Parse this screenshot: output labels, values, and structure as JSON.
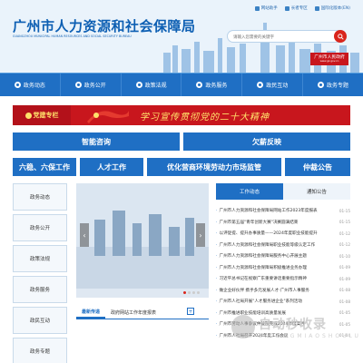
{
  "header": {
    "title": "广州市人力资源和社会保障局",
    "subtitle": "GUANGZHOU MUNICIPAL HUMAN RESOURCES AND SOCIAL SECURITY BUREAU",
    "top_links": [
      "网站助手",
      "长者专区",
      "国际化版本(EN)"
    ],
    "search_placeholder": "请输入您需要的关键字",
    "gov_badge": "广州市人民政府",
    "gov_badge_url": "www.gz.gov.cn"
  },
  "nav": {
    "items": [
      "政务动态",
      "政务公开",
      "政策法规",
      "政务服务",
      "政民互动",
      "政务专题"
    ]
  },
  "banner": {
    "label": "党建专栏",
    "slogan": "学习宣传贯彻党的二十大精神"
  },
  "buttons": {
    "row1": [
      "智能咨询",
      "欠薪反映"
    ],
    "row2": [
      "六稳、六保工作",
      "人才工作",
      "优化营商环境劳动力市场监管",
      "仲裁公告"
    ]
  },
  "left_menu": [
    "政务动态",
    "政务公开",
    "政策法规",
    "政务服务",
    "政民互动",
    "政务专题"
  ],
  "mid_tabs": [
    "最新传递",
    "政府网站工作年度报表"
  ],
  "mid_more": "+",
  "news": {
    "tabs": [
      "工作动态",
      "通知公告"
    ],
    "items": [
      {
        "title": "广州市人力资源和社会保障局网站工作2023年度报表",
        "date": "01-15"
      },
      {
        "title": "广州市第五届\"青年创新大赛\"决赛圆满结束",
        "date": "01-15"
      },
      {
        "title": "以评促提、提升办事质量——2024年度职业技能提升",
        "date": "01-12"
      },
      {
        "title": "广州市人力资源和社会保障局职业技能等级认定工作",
        "date": "01-12"
      },
      {
        "title": "广州市人力资源和社会保障局服务中心开展主题",
        "date": "01-10"
      },
      {
        "title": "广州市人力资源和社会保障局积极推进业务办理",
        "date": "01-09"
      },
      {
        "title": "习近平总书记在视察广东重要讲话重要指示精神",
        "date": "01-09"
      },
      {
        "title": "做企业好伙伴 携手多元发展人才·广州市人事服务",
        "date": "01-08"
      },
      {
        "title": "广州市人社局开展\"人才服务进企业\"系列活动",
        "date": "01-08"
      },
      {
        "title": "广州市推进职业技能培训高质量发展",
        "date": "01-05"
      },
      {
        "title": "广州市劳动人事争议仲裁院完成2024年度案件",
        "date": "01-05"
      },
      {
        "title": "广州市人社局召开2024年度工作会议",
        "date": "01-04"
      }
    ]
  },
  "watermark": {
    "text": "自动秒收录",
    "sub": "ZIDONGMIAOSHOULU"
  }
}
